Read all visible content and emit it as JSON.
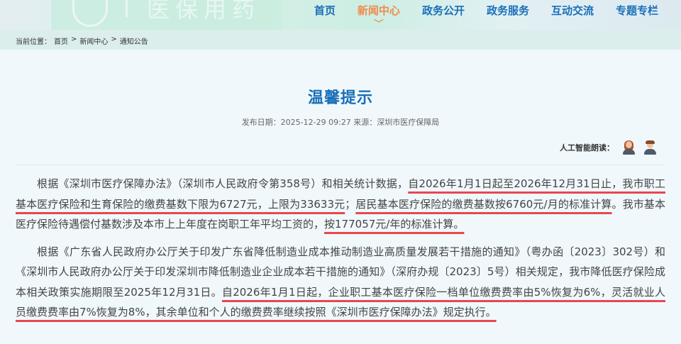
{
  "header": {
    "banner_text": "医保用药",
    "nav": [
      {
        "label": "首页",
        "active": false
      },
      {
        "label": "新闻中心",
        "active": true
      },
      {
        "label": "政务公开",
        "active": false
      },
      {
        "label": "政务服务",
        "active": false
      },
      {
        "label": "互动交流",
        "active": false
      },
      {
        "label": "专题专栏",
        "active": false
      }
    ]
  },
  "breadcrumb": {
    "prefix": "当前位置：",
    "items": [
      "首页",
      "新闻中心",
      "通知公告"
    ],
    "separator": ">"
  },
  "article": {
    "title": "温馨提示",
    "meta": "发布日期：2025-12-29 09:27 来源：深圳市医疗保障局",
    "reader_label": "人工智能朗读：",
    "paragraphs": [
      {
        "segments": [
          {
            "text": "根据《深圳市医疗保障办法》（深圳市人民政府令第358号）和相关统计数据，",
            "underline": false
          },
          {
            "text": "自2026年1月1日起至2026年12月31日止，我市职工基本医疗保险和生育保险的缴费基数下限为6727元，上限为33633元",
            "underline": true
          },
          {
            "text": "；",
            "underline": false
          },
          {
            "text": "居民基本医疗保险的缴费基数按6760元/月的标准计算",
            "underline": true
          },
          {
            "text": "。我市基本医疗保险待遇偿付基数涉及本市上上年度在岗职工年平均工资的，",
            "underline": false
          },
          {
            "text": "按177057元/年的标准计算。",
            "underline": true
          }
        ]
      },
      {
        "segments": [
          {
            "text": "根据《广东省人民政府办公厅关于印发广东省降低制造业成本推动制造业高质量发展若干措施的通知》（粤办函〔2023〕302号）和《深圳市人民政府办公厅关于印发深圳市降低制造业企业成本若干措施的通知》（深府办规〔2023〕5号）相关规定，我市降低医疗保险成本相关政策实施期限至2025年12月31日。",
            "underline": false
          },
          {
            "text": "自2026年1月1日起，企业职工基本医疗保险一档单位缴费费率由5%恢复为6%，灵活就业人员缴费费率由7%恢复为8%，其余单位和个人的缴费费率继续按照《深圳市医疗保障办法》规定执行。",
            "underline": true
          }
        ]
      }
    ]
  },
  "colors": {
    "nav": "#1a6fb8",
    "nav_active": "#f08a4b",
    "underline": "#e8474d",
    "title": "#1a6fb8"
  }
}
